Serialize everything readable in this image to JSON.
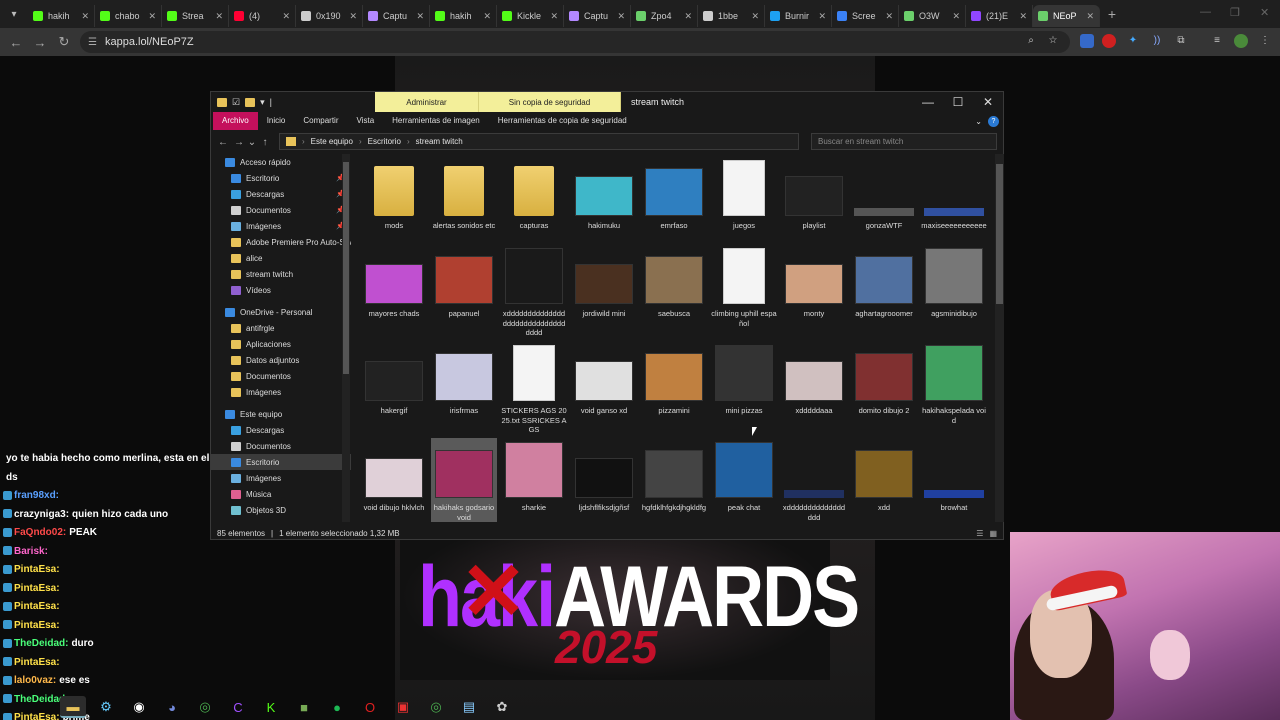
{
  "browser": {
    "tabs": [
      {
        "label": "hakih",
        "color": "#53fc18"
      },
      {
        "label": "chabo",
        "color": "#53fc18"
      },
      {
        "label": "Strea",
        "color": "#53fc18"
      },
      {
        "label": "(4)",
        "color": "#ff0033"
      },
      {
        "label": "0x190",
        "color": "#cccccc"
      },
      {
        "label": "Captu",
        "color": "#b388ff"
      },
      {
        "label": "hakih",
        "color": "#53fc18"
      },
      {
        "label": "Kickle",
        "color": "#53fc18"
      },
      {
        "label": "Captu",
        "color": "#b388ff"
      },
      {
        "label": "Zpo4",
        "color": "#6bcf6b"
      },
      {
        "label": "1bbe",
        "color": "#cccccc"
      },
      {
        "label": "Burnir",
        "color": "#1da1f2"
      },
      {
        "label": "Scree",
        "color": "#3b82f6"
      },
      {
        "label": "O3W",
        "color": "#6bcf6b"
      },
      {
        "label": "(21)E",
        "color": "#9146ff"
      },
      {
        "label": "NEoP",
        "color": "#6bcf6b"
      }
    ],
    "url": "kappa.lol/NEoP7Z"
  },
  "explorer": {
    "title": "stream twitch",
    "ctx_admin": "Administrar",
    "ctx_backup": "Sin copia de seguridad",
    "ribbon_tabs": [
      "Archivo",
      "Inicio",
      "Compartir",
      "Vista",
      "Herramientas de imagen",
      "Herramientas de copia de seguridad"
    ],
    "path": [
      "Este equipo",
      "Escritorio",
      "stream twitch"
    ],
    "search_placeholder": "Buscar en stream twitch",
    "nav": [
      {
        "label": "Acceso rápido",
        "type": "star",
        "indent": 0
      },
      {
        "label": "Escritorio",
        "type": "desk",
        "indent": 1,
        "pin": true
      },
      {
        "label": "Descargas",
        "type": "down",
        "indent": 1,
        "pin": true
      },
      {
        "label": "Documentos",
        "type": "doc",
        "indent": 1,
        "pin": true
      },
      {
        "label": "Imágenes",
        "type": "img",
        "indent": 1,
        "pin": true
      },
      {
        "label": "Adobe Premiere Pro Auto-Save",
        "type": "folder",
        "indent": 1
      },
      {
        "label": "alice",
        "type": "folder",
        "indent": 1
      },
      {
        "label": "stream twitch",
        "type": "folder",
        "indent": 1
      },
      {
        "label": "Vídeos",
        "type": "vid",
        "indent": 1
      },
      {
        "label": "",
        "type": "gap",
        "indent": 0
      },
      {
        "label": "OneDrive - Personal",
        "type": "cloud",
        "indent": 0
      },
      {
        "label": "antifrgle",
        "type": "folder",
        "indent": 1
      },
      {
        "label": "Aplicaciones",
        "type": "folder",
        "indent": 1
      },
      {
        "label": "Datos adjuntos",
        "type": "folder",
        "indent": 1
      },
      {
        "label": "Documentos",
        "type": "folder",
        "indent": 1
      },
      {
        "label": "Imágenes",
        "type": "folder",
        "indent": 1
      },
      {
        "label": "",
        "type": "gap",
        "indent": 0
      },
      {
        "label": "Este equipo",
        "type": "pc",
        "indent": 0
      },
      {
        "label": "Descargas",
        "type": "down",
        "indent": 1
      },
      {
        "label": "Documentos",
        "type": "doc",
        "indent": 1
      },
      {
        "label": "Escritorio",
        "type": "desk",
        "indent": 1,
        "selected": true
      },
      {
        "label": "Imágenes",
        "type": "img",
        "indent": 1
      },
      {
        "label": "Música",
        "type": "music",
        "indent": 1
      },
      {
        "label": "Objetos 3D",
        "type": "obj",
        "indent": 1
      }
    ],
    "items": [
      {
        "label": "mods",
        "kind": "folder"
      },
      {
        "label": "alertas sonidos etc",
        "kind": "folder"
      },
      {
        "label": "capturas",
        "kind": "folder"
      },
      {
        "label": "hakimuku",
        "kind": "image",
        "color": "#3fb7c9"
      },
      {
        "label": "emrfaso",
        "kind": "image",
        "color": "#2f7fc0"
      },
      {
        "label": "juegos",
        "kind": "file"
      },
      {
        "label": "playlist",
        "kind": "image",
        "color": "#222"
      },
      {
        "label": "gonzaWTF",
        "kind": "strip",
        "color": "#555"
      },
      {
        "label": "maxiseeeeeeeeeee",
        "kind": "strip",
        "color": "#3050a0"
      },
      {
        "label": "mayores chads",
        "kind": "image",
        "color": "#c050d0"
      },
      {
        "label": "papanuel",
        "kind": "image",
        "color": "#b04030"
      },
      {
        "label": "xddddddddddddddddddddddddddddddddd",
        "kind": "image",
        "color": "#1a1a1a"
      },
      {
        "label": "jordiwild mini",
        "kind": "image",
        "color": "#4a3020"
      },
      {
        "label": "saebusca",
        "kind": "image",
        "color": "#8a7050"
      },
      {
        "label": "climbing uphill español",
        "kind": "file"
      },
      {
        "label": "monty",
        "kind": "image",
        "color": "#d0a080"
      },
      {
        "label": "aghartagrooomer",
        "kind": "image",
        "color": "#5070a0"
      },
      {
        "label": "agsminidibujo",
        "kind": "image",
        "color": "#777"
      },
      {
        "label": "hakergif",
        "kind": "image",
        "color": "#222"
      },
      {
        "label": "irisfrmas",
        "kind": "image",
        "color": "#c8c8e0"
      },
      {
        "label": "STICKERS AGS 2025.txt SSRICKES AGS",
        "kind": "file"
      },
      {
        "label": "void ganso xd",
        "kind": "image",
        "color": "#e0e0e0"
      },
      {
        "label": "pizzamini",
        "kind": "image",
        "color": "#c08040"
      },
      {
        "label": "mini pizzas",
        "kind": "image",
        "color": "#333"
      },
      {
        "label": "xdddddaaa",
        "kind": "image",
        "color": "#d0c0c0"
      },
      {
        "label": "domito dibujo 2",
        "kind": "image",
        "color": "#803030"
      },
      {
        "label": "hakihakspelada void",
        "kind": "image",
        "color": "#40a060"
      },
      {
        "label": "void dibujo hklvlch",
        "kind": "image",
        "color": "#e0d0d8"
      },
      {
        "label": "hakihaks godsario void",
        "kind": "image",
        "color": "#a03060",
        "selected": true
      },
      {
        "label": "sharkie",
        "kind": "image",
        "color": "#d080a0"
      },
      {
        "label": "ljdshflfiksdjgñsf",
        "kind": "image",
        "color": "#111"
      },
      {
        "label": "hgfdklhfgkdjhgkldfg",
        "kind": "image",
        "color": "#444"
      },
      {
        "label": "peak chat",
        "kind": "image",
        "color": "#2060a0"
      },
      {
        "label": "xddddddddddddddddd",
        "kind": "strip",
        "color": "#203060"
      },
      {
        "label": "xdd",
        "kind": "image",
        "color": "#806020"
      },
      {
        "label": "browhat",
        "kind": "strip",
        "color": "#2040a0"
      }
    ],
    "status_count": "85 elementos",
    "status_selected": "1 elemento seleccionado  1,32 MB"
  },
  "chat": [
    {
      "user": "",
      "text": "yo te habia hecho como merlina, esta en el",
      "color": "#7ac"
    },
    {
      "user": "",
      "text": "ds",
      "color": "#fff"
    },
    {
      "user": "fran98xd:",
      "text": "",
      "color": "#5aa0ff"
    },
    {
      "user": "crazyniga3:",
      "text": "quien hizo cada uno",
      "color": "#ffffff"
    },
    {
      "user": "FaQndo02:",
      "text": "PEAK",
      "color": "#ff4a4a"
    },
    {
      "user": "Barisk:",
      "text": "",
      "color": "#ff66cc"
    },
    {
      "user": "PintaEsa:",
      "text": "",
      "color": "#ffe14a"
    },
    {
      "user": "PintaEsa:",
      "text": "",
      "color": "#ffe14a"
    },
    {
      "user": "PintaEsa:",
      "text": "",
      "color": "#ffe14a"
    },
    {
      "user": "PintaEsa:",
      "text": "",
      "color": "#ffe14a"
    },
    {
      "user": "TheDeidad:",
      "text": "duro",
      "color": "#4aff7a"
    },
    {
      "user": "PintaEsa:",
      "text": "",
      "color": "#ffe14a"
    },
    {
      "user": "lalo0vaz:",
      "text": "ese es",
      "color": "#ffb84a"
    },
    {
      "user": "TheDeidad:",
      "text": "",
      "color": "#4aff7a"
    },
    {
      "user": "PintaEsa:",
      "text": "prime",
      "color": "#ffe14a"
    }
  ],
  "overlay": {
    "awards_prefix": "haki",
    "awards_main": "AWARDS",
    "year": "2025"
  }
}
